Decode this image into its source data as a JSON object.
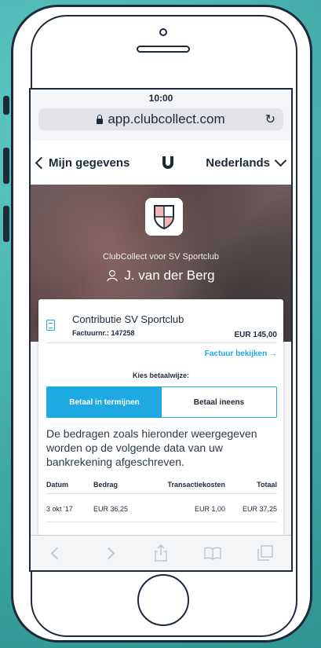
{
  "status_bar": {
    "time": "10:00"
  },
  "browser": {
    "url": "app.clubcollect.com"
  },
  "nav": {
    "back_label": "Mijn gegevens",
    "language": "Nederlands"
  },
  "hero": {
    "subtitle": "ClubCollect voor SV Sportclub",
    "member_name": "J. van der Berg"
  },
  "invoice": {
    "title": "Contributie SV Sportclub",
    "number": "Factuurnr.: 147258",
    "amount": "EUR 145,00",
    "view_link": "Factuur bekijken →"
  },
  "payment": {
    "heading": "Kies betaalwijze:",
    "options": [
      {
        "label": "Betaal in termijnen",
        "active": true
      },
      {
        "label": "Betaal ineens",
        "active": false
      }
    ],
    "info_text": "De bedragen zoals hieronder weergegeven worden op de volgende data van uw bankrekening afgeschreven."
  },
  "schedule": {
    "columns": [
      "Datum",
      "Bedrag",
      "Transactiekosten",
      "Totaal"
    ],
    "rows": [
      [
        "3 okt '17",
        "EUR 36,25",
        "EUR 1,00",
        "EUR 37,25"
      ]
    ]
  },
  "toolbar": {
    "icons": [
      "back-icon",
      "forward-icon",
      "share-icon",
      "bookmarks-icon",
      "tabs-icon"
    ]
  },
  "colors": {
    "background": "#46b6b3",
    "accent": "#1fa9e2",
    "text": "#1d2a3a"
  }
}
